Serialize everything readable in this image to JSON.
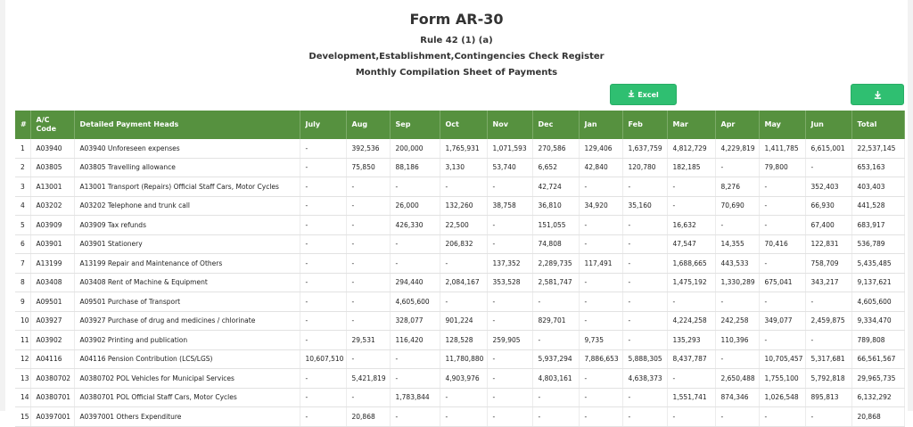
{
  "header": {
    "title": "Form AR-30",
    "rule": "Rule 42 (1) (a)",
    "register": "Development,Establishment,Contingencies Check Register",
    "sheet": "Monthly Compilation Sheet of Payments"
  },
  "toolbar": {
    "excel_label": "Excel",
    "download_icon": "download-icon",
    "accent_color": "#2fbf71"
  },
  "table": {
    "header_color": "#56913f",
    "columns": [
      "#",
      "A/C Code",
      "Detailed Payment Heads",
      "July",
      "Aug",
      "Sep",
      "Oct",
      "Nov",
      "Dec",
      "Jan",
      "Feb",
      "Mar",
      "Apr",
      "May",
      "Jun",
      "Total"
    ],
    "rows": [
      [
        "1",
        "A03940",
        "A03940 Unforeseen expenses",
        "-",
        "392,536",
        "200,000",
        "1,765,931",
        "1,071,593",
        "270,586",
        "129,406",
        "1,637,759",
        "4,812,729",
        "4,229,819",
        "1,411,785",
        "6,615,001",
        "22,537,145"
      ],
      [
        "2",
        "A03805",
        "A03805 Travelling allowance",
        "-",
        "75,850",
        "88,186",
        "3,130",
        "53,740",
        "6,652",
        "42,840",
        "120,780",
        "182,185",
        "-",
        "79,800",
        "-",
        "653,163"
      ],
      [
        "3",
        "A13001",
        "A13001 Transport (Repairs) Official Staff Cars, Motor Cycles",
        "-",
        "-",
        "-",
        "-",
        "-",
        "42,724",
        "-",
        "-",
        "-",
        "8,276",
        "-",
        "352,403",
        "403,403"
      ],
      [
        "4",
        "A03202",
        "A03202 Telephone and trunk call",
        "-",
        "-",
        "26,000",
        "132,260",
        "38,758",
        "36,810",
        "34,920",
        "35,160",
        "-",
        "70,690",
        "-",
        "66,930",
        "441,528"
      ],
      [
        "5",
        "A03909",
        "A03909 Tax refunds",
        "-",
        "-",
        "426,330",
        "22,500",
        "-",
        "151,055",
        "-",
        "-",
        "16,632",
        "-",
        "-",
        "67,400",
        "683,917"
      ],
      [
        "6",
        "A03901",
        "A03901 Stationery",
        "-",
        "-",
        "-",
        "206,832",
        "-",
        "74,808",
        "-",
        "-",
        "47,547",
        "14,355",
        "70,416",
        "122,831",
        "536,789"
      ],
      [
        "7",
        "A13199",
        "A13199 Repair and Maintenance of Others",
        "-",
        "-",
        "-",
        "-",
        "137,352",
        "2,289,735",
        "117,491",
        "-",
        "1,688,665",
        "443,533",
        "-",
        "758,709",
        "5,435,485"
      ],
      [
        "8",
        "A03408",
        "A03408 Rent of Machine & Equipment",
        "-",
        "-",
        "294,440",
        "2,084,167",
        "353,528",
        "2,581,747",
        "-",
        "-",
        "1,475,192",
        "1,330,289",
        "675,041",
        "343,217",
        "9,137,621"
      ],
      [
        "9",
        "A09501",
        "A09501 Purchase of Transport",
        "-",
        "-",
        "4,605,600",
        "-",
        "-",
        "-",
        "-",
        "-",
        "-",
        "-",
        "-",
        "-",
        "4,605,600"
      ],
      [
        "10",
        "A03927",
        "A03927 Purchase of drug and medicines / chlorinate",
        "-",
        "-",
        "328,077",
        "901,224",
        "-",
        "829,701",
        "-",
        "-",
        "4,224,258",
        "242,258",
        "349,077",
        "2,459,875",
        "9,334,470"
      ],
      [
        "11",
        "A03902",
        "A03902 Printing and publication",
        "-",
        "29,531",
        "116,420",
        "128,528",
        "259,905",
        "-",
        "9,735",
        "-",
        "135,293",
        "110,396",
        "-",
        "-",
        "789,808"
      ],
      [
        "12",
        "A04116",
        "A04116 Pension Contribution (LCS/LGS)",
        "10,607,510",
        "-",
        "-",
        "11,780,880",
        "-",
        "5,937,294",
        "7,886,653",
        "5,888,305",
        "8,437,787",
        "-",
        "10,705,457",
        "5,317,681",
        "66,561,567"
      ],
      [
        "13",
        "A0380702",
        "A0380702 POL Vehicles for Municipal Services",
        "-",
        "5,421,819",
        "-",
        "4,903,976",
        "-",
        "4,803,161",
        "-",
        "4,638,373",
        "-",
        "2,650,488",
        "1,755,100",
        "5,792,818",
        "29,965,735"
      ],
      [
        "14",
        "A0380701",
        "A0380701 POL Official Staff Cars, Motor Cycles",
        "-",
        "-",
        "1,783,844",
        "-",
        "-",
        "-",
        "-",
        "-",
        "1,551,741",
        "874,346",
        "1,026,548",
        "895,813",
        "6,132,292"
      ],
      [
        "15",
        "A0397001",
        "A0397001 Others Expenditure",
        "-",
        "20,868",
        "-",
        "-",
        "-",
        "-",
        "-",
        "-",
        "-",
        "-",
        "-",
        "-",
        "20,868"
      ]
    ]
  }
}
